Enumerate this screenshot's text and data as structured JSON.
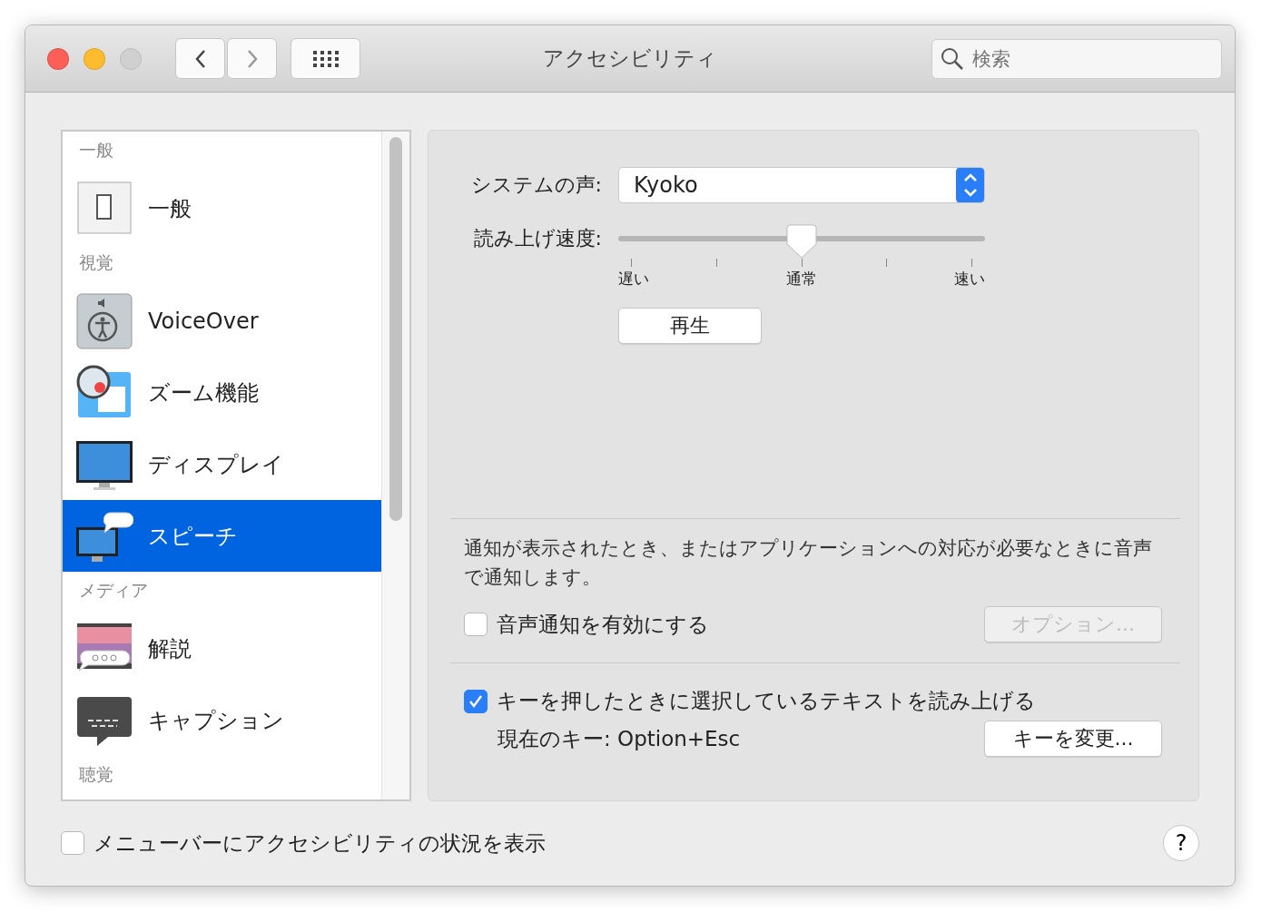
{
  "window": {
    "title": "アクセシビリティ"
  },
  "toolbar": {
    "search": {
      "placeholder": "検索"
    }
  },
  "sidebar": {
    "items": [
      {
        "kind": "header",
        "label": "一般"
      },
      {
        "kind": "item",
        "label": "一般",
        "selected": false
      },
      {
        "kind": "header",
        "label": "視覚"
      },
      {
        "kind": "item",
        "label": "VoiceOver",
        "selected": false
      },
      {
        "kind": "item",
        "label": "ズーム機能",
        "selected": false
      },
      {
        "kind": "item",
        "label": "ディスプレイ",
        "selected": false
      },
      {
        "kind": "item",
        "label": "スピーチ",
        "selected": true
      },
      {
        "kind": "header",
        "label": "メディア"
      },
      {
        "kind": "item",
        "label": "解説",
        "selected": false
      },
      {
        "kind": "item",
        "label": "キャプション",
        "selected": false
      },
      {
        "kind": "header",
        "label": "聴覚"
      }
    ]
  },
  "speech": {
    "voice_label": "システムの声:",
    "voice": "Kyoko",
    "rate_label": "読み上げ速度:",
    "rate": {
      "level": 0.5,
      "tick_labels": [
        "遅い",
        "通常",
        "速い"
      ]
    },
    "play_button": "再生"
  },
  "announcements": {
    "description": "通知が表示されたとき、またはアプリケーションへの対応が必要なときに音声で通知します。",
    "checkbox": {
      "label": "音声通知を有効にする",
      "checked": false
    },
    "options_button": {
      "label": "オプション...",
      "disabled": true
    }
  },
  "speak_selection": {
    "checkbox": {
      "label": "キーを押したときに選択しているテキストを読み上げる",
      "checked": true
    },
    "current_key": "現在のキー: Option+Esc",
    "change_key_button": "キーを変更..."
  },
  "footer": {
    "checkbox": {
      "label": "メニューバーにアクセシビリティの状況を表示",
      "checked": false
    },
    "help_button": "?"
  }
}
